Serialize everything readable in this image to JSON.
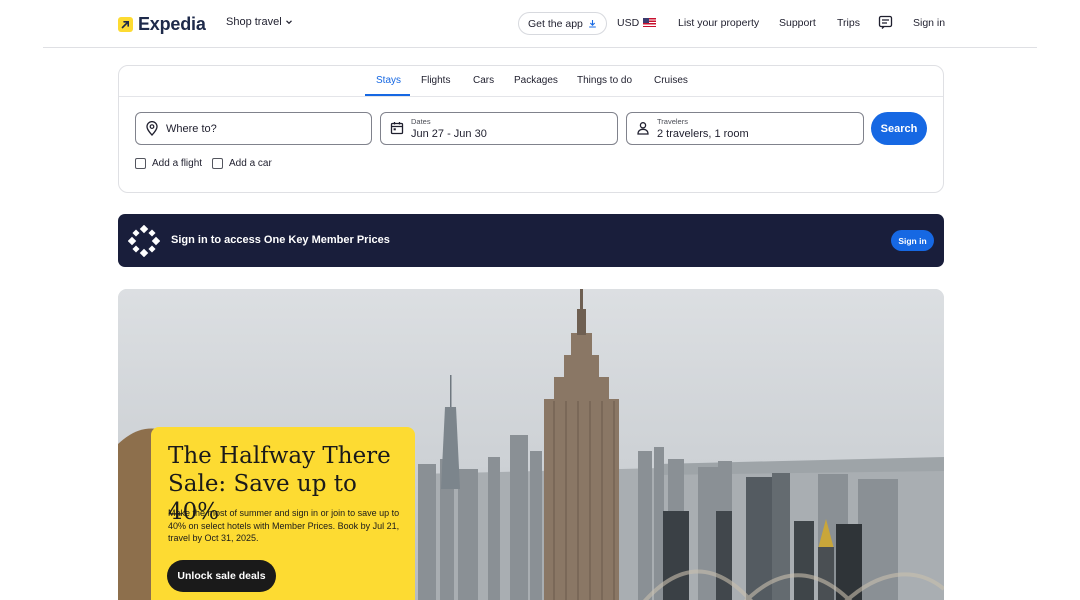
{
  "header": {
    "logo_text": "Expedia",
    "shop_travel": "Shop travel",
    "get_app": "Get the app",
    "currency": "USD",
    "list_property": "List your property",
    "support": "Support",
    "trips": "Trips",
    "sign_in": "Sign in"
  },
  "search": {
    "tabs": [
      {
        "label": "Stays",
        "active": true
      },
      {
        "label": "Flights"
      },
      {
        "label": "Cars"
      },
      {
        "label": "Packages"
      },
      {
        "label": "Things to do"
      },
      {
        "label": "Cruises"
      }
    ],
    "where_placeholder": "Where to?",
    "dates_label": "Dates",
    "dates_value": "Jun 27 - Jun 30",
    "travelers_label": "Travelers",
    "travelers_value": "2 travelers, 1 room",
    "search_button": "Search",
    "add_flight": "Add a flight",
    "add_car": "Add a car"
  },
  "banner": {
    "text": "Sign in to access One Key Member Prices",
    "button": "Sign in"
  },
  "promo": {
    "title": "The Halfway There Sale: Save up to 40%",
    "body": "Make the most of summer and sign in or join to save up to 40% on select hotels with Member Prices. Book by Jul 21, travel by Oct 31, 2025.",
    "button": "Unlock sale deals"
  },
  "colors": {
    "brand_blue": "#1668e3",
    "brand_yellow": "#fddb32",
    "banner_navy": "#191e3b"
  },
  "icons": [
    "arrow-logo-icon",
    "chevron-down-icon",
    "download-icon",
    "us-flag-icon",
    "chat-icon",
    "map-pin-icon",
    "calendar-icon",
    "person-icon",
    "one-key-icon"
  ]
}
